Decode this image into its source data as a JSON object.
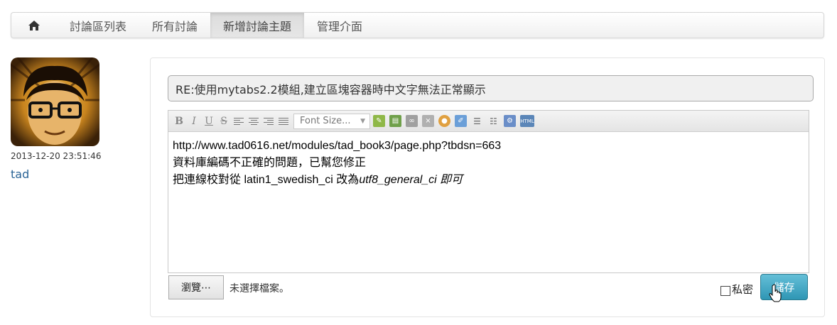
{
  "nav": {
    "home_icon": "home-icon",
    "items": [
      {
        "label": "討論區列表"
      },
      {
        "label": "所有討論"
      },
      {
        "label": "新增討論主題",
        "active": true
      },
      {
        "label": "管理介面"
      }
    ]
  },
  "post": {
    "timestamp": "2013-12-20 23:51:46",
    "username": "tad"
  },
  "form": {
    "title_value": "RE:使用mytabs2.2模組,建立區塊容器時中文字無法正常顯示",
    "toolbar": {
      "font_size_placeholder": "Font Size...",
      "icons": [
        "bold-icon",
        "italic-icon",
        "underline-icon",
        "strikethrough-icon",
        "align-left-icon",
        "align-center-icon",
        "align-right-icon",
        "justify-icon",
        "edit-icon",
        "insert-icon",
        "link-icon",
        "unlink-icon",
        "color-icon",
        "note-icon",
        "ordered-list-icon",
        "unordered-list-icon",
        "settings-icon",
        "html-icon"
      ]
    },
    "body": {
      "line1": "http://www.tad0616.net/modules/tad_book3/page.php?tbdsn=663",
      "line2": "資料庫編碼不正確的問題，已幫您修正",
      "line3_prefix": "把連線校對從 latin1_swedish_ci 改為",
      "line3_italic": "utf8_general_ci 即可"
    },
    "browse_label": "瀏覽⋯",
    "no_file_label": "未選擇檔案。",
    "private_label": "私密",
    "save_label": "儲存"
  },
  "colors": {
    "save_button": "#2f96b4",
    "username_link": "#2a6496",
    "title_background": "#f0f0f0"
  }
}
